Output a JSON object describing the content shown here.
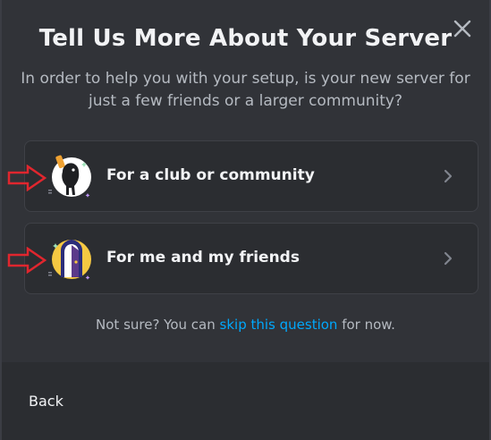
{
  "modal": {
    "title": "Tell Us More About Your Server",
    "subtitle": "In order to help you with your setup, is your new server for just a few friends or a larger community?",
    "close_icon": "close-icon"
  },
  "options": [
    {
      "label": "For a club or community",
      "icon": "club-community-icon",
      "chevron": "chevron-right-icon"
    },
    {
      "label": "For me and my friends",
      "icon": "friends-door-icon",
      "chevron": "chevron-right-icon"
    }
  ],
  "annotations": {
    "arrow_color": "#e0262e",
    "arrow_icon": "red-arrow-icon"
  },
  "footnote": {
    "prefix": "Not sure? You can",
    "link": "skip this question",
    "suffix": "for now."
  },
  "footer": {
    "back_label": "Back"
  },
  "colors": {
    "background": "#313338",
    "card": "#2b2d31",
    "link": "#00a8fc",
    "text": "#f2f3f5",
    "muted": "#b5bac1"
  }
}
